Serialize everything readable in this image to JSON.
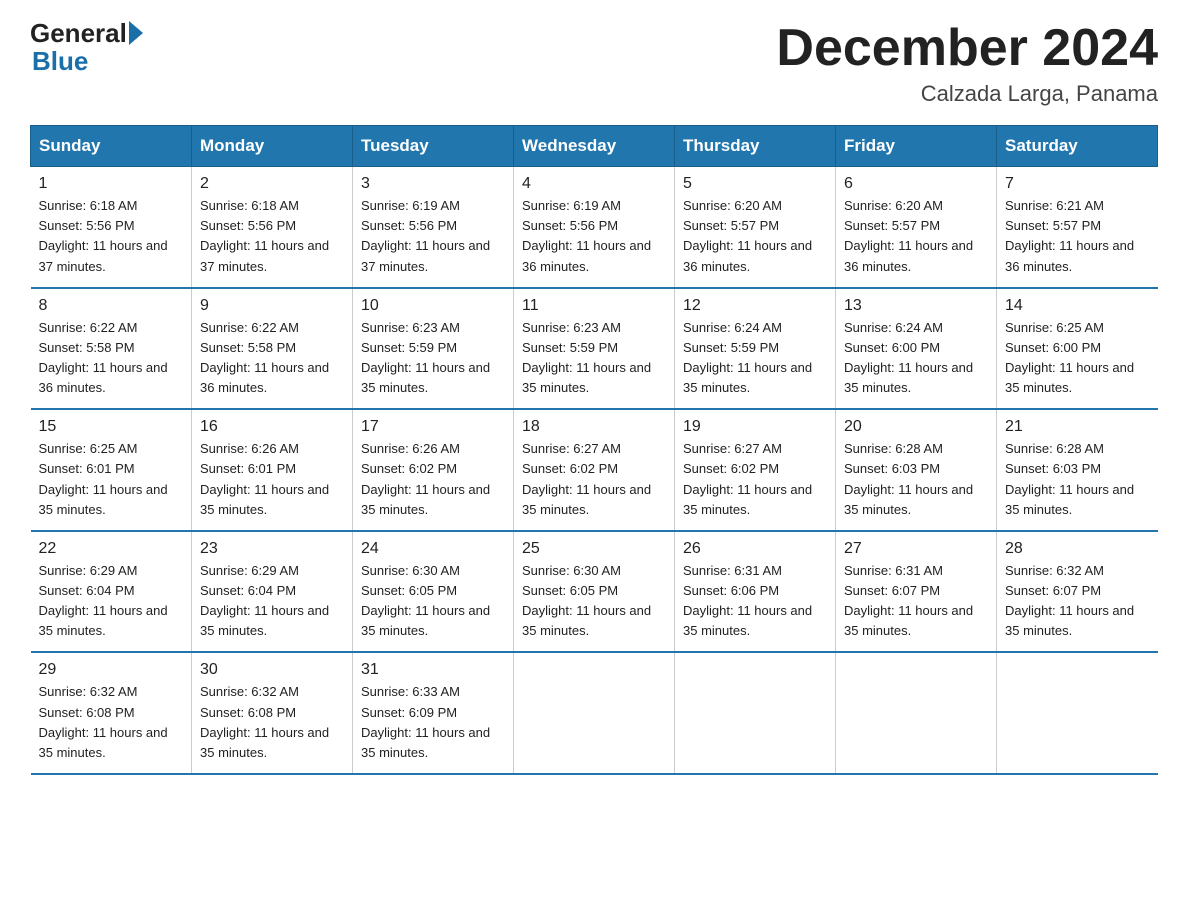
{
  "logo": {
    "general": "General",
    "blue": "Blue"
  },
  "title": "December 2024",
  "subtitle": "Calzada Larga, Panama",
  "days_of_week": [
    "Sunday",
    "Monday",
    "Tuesday",
    "Wednesday",
    "Thursday",
    "Friday",
    "Saturday"
  ],
  "weeks": [
    [
      {
        "num": "1",
        "sunrise": "6:18 AM",
        "sunset": "5:56 PM",
        "daylight": "11 hours and 37 minutes."
      },
      {
        "num": "2",
        "sunrise": "6:18 AM",
        "sunset": "5:56 PM",
        "daylight": "11 hours and 37 minutes."
      },
      {
        "num": "3",
        "sunrise": "6:19 AM",
        "sunset": "5:56 PM",
        "daylight": "11 hours and 37 minutes."
      },
      {
        "num": "4",
        "sunrise": "6:19 AM",
        "sunset": "5:56 PM",
        "daylight": "11 hours and 36 minutes."
      },
      {
        "num": "5",
        "sunrise": "6:20 AM",
        "sunset": "5:57 PM",
        "daylight": "11 hours and 36 minutes."
      },
      {
        "num": "6",
        "sunrise": "6:20 AM",
        "sunset": "5:57 PM",
        "daylight": "11 hours and 36 minutes."
      },
      {
        "num": "7",
        "sunrise": "6:21 AM",
        "sunset": "5:57 PM",
        "daylight": "11 hours and 36 minutes."
      }
    ],
    [
      {
        "num": "8",
        "sunrise": "6:22 AM",
        "sunset": "5:58 PM",
        "daylight": "11 hours and 36 minutes."
      },
      {
        "num": "9",
        "sunrise": "6:22 AM",
        "sunset": "5:58 PM",
        "daylight": "11 hours and 36 minutes."
      },
      {
        "num": "10",
        "sunrise": "6:23 AM",
        "sunset": "5:59 PM",
        "daylight": "11 hours and 35 minutes."
      },
      {
        "num": "11",
        "sunrise": "6:23 AM",
        "sunset": "5:59 PM",
        "daylight": "11 hours and 35 minutes."
      },
      {
        "num": "12",
        "sunrise": "6:24 AM",
        "sunset": "5:59 PM",
        "daylight": "11 hours and 35 minutes."
      },
      {
        "num": "13",
        "sunrise": "6:24 AM",
        "sunset": "6:00 PM",
        "daylight": "11 hours and 35 minutes."
      },
      {
        "num": "14",
        "sunrise": "6:25 AM",
        "sunset": "6:00 PM",
        "daylight": "11 hours and 35 minutes."
      }
    ],
    [
      {
        "num": "15",
        "sunrise": "6:25 AM",
        "sunset": "6:01 PM",
        "daylight": "11 hours and 35 minutes."
      },
      {
        "num": "16",
        "sunrise": "6:26 AM",
        "sunset": "6:01 PM",
        "daylight": "11 hours and 35 minutes."
      },
      {
        "num": "17",
        "sunrise": "6:26 AM",
        "sunset": "6:02 PM",
        "daylight": "11 hours and 35 minutes."
      },
      {
        "num": "18",
        "sunrise": "6:27 AM",
        "sunset": "6:02 PM",
        "daylight": "11 hours and 35 minutes."
      },
      {
        "num": "19",
        "sunrise": "6:27 AM",
        "sunset": "6:02 PM",
        "daylight": "11 hours and 35 minutes."
      },
      {
        "num": "20",
        "sunrise": "6:28 AM",
        "sunset": "6:03 PM",
        "daylight": "11 hours and 35 minutes."
      },
      {
        "num": "21",
        "sunrise": "6:28 AM",
        "sunset": "6:03 PM",
        "daylight": "11 hours and 35 minutes."
      }
    ],
    [
      {
        "num": "22",
        "sunrise": "6:29 AM",
        "sunset": "6:04 PM",
        "daylight": "11 hours and 35 minutes."
      },
      {
        "num": "23",
        "sunrise": "6:29 AM",
        "sunset": "6:04 PM",
        "daylight": "11 hours and 35 minutes."
      },
      {
        "num": "24",
        "sunrise": "6:30 AM",
        "sunset": "6:05 PM",
        "daylight": "11 hours and 35 minutes."
      },
      {
        "num": "25",
        "sunrise": "6:30 AM",
        "sunset": "6:05 PM",
        "daylight": "11 hours and 35 minutes."
      },
      {
        "num": "26",
        "sunrise": "6:31 AM",
        "sunset": "6:06 PM",
        "daylight": "11 hours and 35 minutes."
      },
      {
        "num": "27",
        "sunrise": "6:31 AM",
        "sunset": "6:07 PM",
        "daylight": "11 hours and 35 minutes."
      },
      {
        "num": "28",
        "sunrise": "6:32 AM",
        "sunset": "6:07 PM",
        "daylight": "11 hours and 35 minutes."
      }
    ],
    [
      {
        "num": "29",
        "sunrise": "6:32 AM",
        "sunset": "6:08 PM",
        "daylight": "11 hours and 35 minutes."
      },
      {
        "num": "30",
        "sunrise": "6:32 AM",
        "sunset": "6:08 PM",
        "daylight": "11 hours and 35 minutes."
      },
      {
        "num": "31",
        "sunrise": "6:33 AM",
        "sunset": "6:09 PM",
        "daylight": "11 hours and 35 minutes."
      },
      null,
      null,
      null,
      null
    ]
  ]
}
